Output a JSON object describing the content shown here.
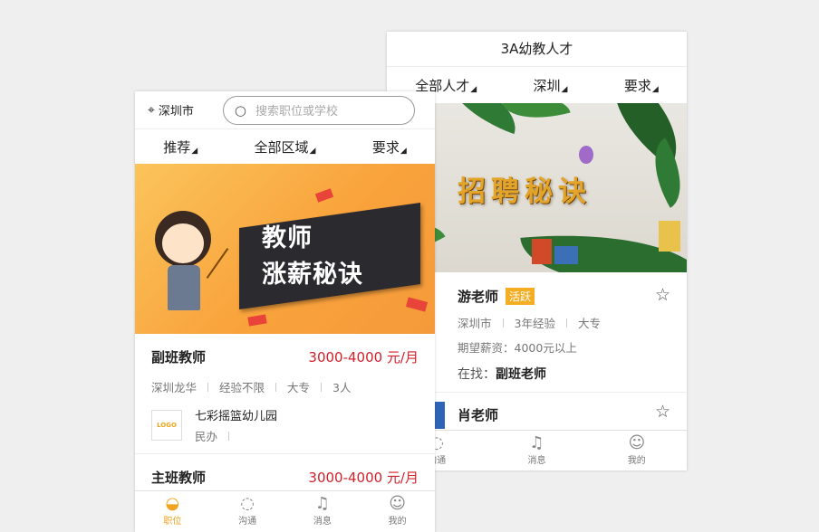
{
  "right_screen": {
    "title": "3A幼教人才",
    "filters": [
      "全部人才",
      "深圳",
      "要求"
    ],
    "banner_text": "招聘秘诀",
    "candidates": [
      {
        "name": "游老师",
        "tag": "活跃",
        "city": "深圳市",
        "experience": "3年经验",
        "education": "大专",
        "salary_label": "期望薪资：",
        "salary": "4000元以上",
        "seeking_label": "在找：",
        "seeking": "副班老师"
      },
      {
        "name": "肖老师"
      }
    ],
    "tabs": [
      "沟通",
      "消息",
      "我的"
    ]
  },
  "left_screen": {
    "city": "深圳市",
    "search_placeholder": "搜索职位或学校",
    "filters": [
      "推荐",
      "全部区域",
      "要求"
    ],
    "banner_line1": "教师",
    "banner_line2": "涨薪秘诀",
    "jobs": [
      {
        "title": "副班教师",
        "salary": "3000-4000 元/月",
        "location": "深圳龙华",
        "experience": "经验不限",
        "education": "大专",
        "headcount": "3人",
        "logo_text": "LOGO",
        "school": "七彩摇篮幼儿园",
        "school_type": "民办"
      },
      {
        "title": "主班教师",
        "salary": "3000-4000 元/月"
      }
    ],
    "tabs": [
      "职位",
      "沟通",
      "消息",
      "我的"
    ]
  },
  "colors": {
    "salary": "#d2202b",
    "tag": "#f5ad23",
    "active_tab": "#f0a31d"
  },
  "icons": [
    "location-pin-icon",
    "search-icon",
    "star-icon",
    "chat-icon",
    "bell-icon",
    "user-icon",
    "briefcase-icon"
  ]
}
